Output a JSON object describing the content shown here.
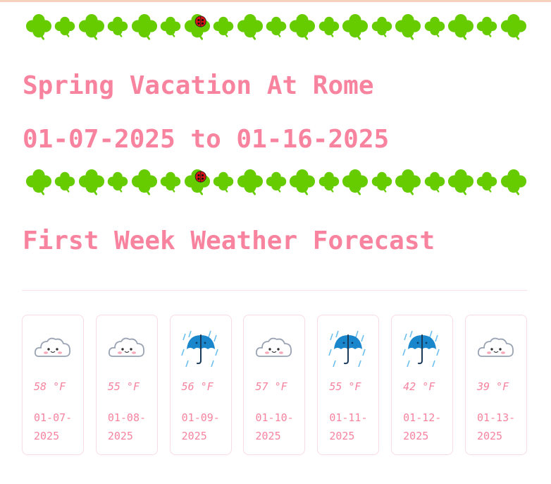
{
  "decorations": {
    "border_row": [
      "clover",
      "clover",
      "clover",
      "clover",
      "clover",
      "clover",
      "clover-ladybug",
      "clover",
      "clover",
      "clover",
      "clover",
      "clover",
      "clover",
      "clover",
      "clover",
      "clover",
      "clover",
      "clover",
      "clover"
    ]
  },
  "header": {
    "title": "Spring Vacation At Rome",
    "date_range": "01-07-2025 to 01-16-2025"
  },
  "forecast": {
    "heading": "First Week Weather Forecast",
    "days": [
      {
        "icon": "cloud-icon",
        "temp": "58 °F",
        "date": "01-07-2025"
      },
      {
        "icon": "cloud-icon",
        "temp": "55 °F",
        "date": "01-08-2025"
      },
      {
        "icon": "umbrella-rain-icon",
        "temp": "56 °F",
        "date": "01-09-2025"
      },
      {
        "icon": "cloud-icon",
        "temp": "57 °F",
        "date": "01-10-2025"
      },
      {
        "icon": "umbrella-rain-icon",
        "temp": "55 °F",
        "date": "01-11-2025"
      },
      {
        "icon": "umbrella-rain-icon",
        "temp": "42 °F",
        "date": "01-12-2025"
      },
      {
        "icon": "cloud-icon",
        "temp": "39 °F",
        "date": "01-13-2025"
      }
    ]
  },
  "colors": {
    "accent": "#f7839f",
    "clover": "#66cc00",
    "ladybug": "#dd1111",
    "umbrella": "#1a86cc",
    "card_border": "#f9dbe3"
  }
}
